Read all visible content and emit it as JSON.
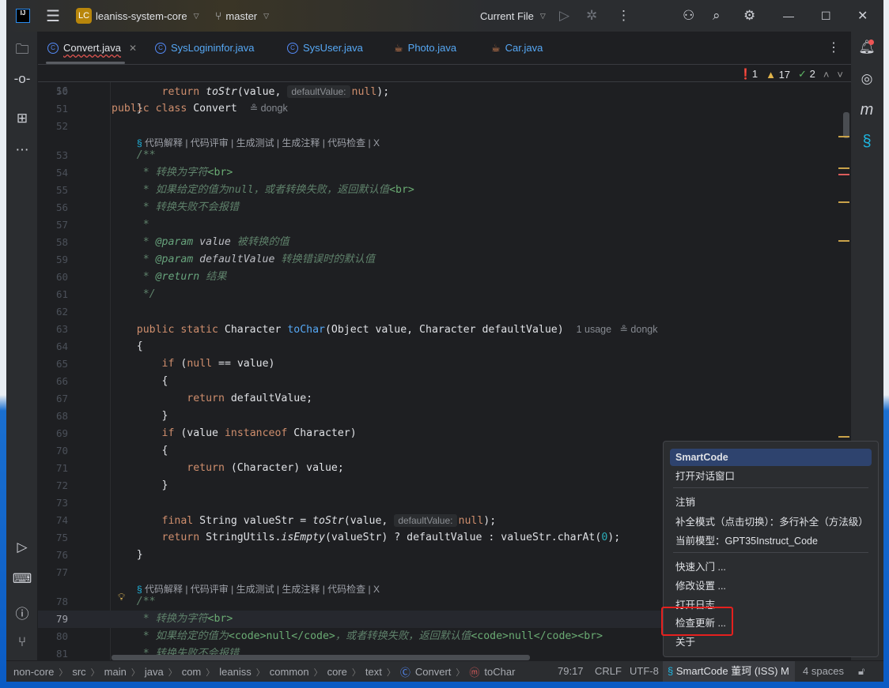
{
  "titlebar": {
    "project_badge": "LC",
    "project": "leaniss-system-core",
    "branch": "master",
    "run_config": "Current File"
  },
  "tabs": [
    {
      "label": "Convert.java",
      "kind": "class",
      "active": true
    },
    {
      "label": "SysLogininfor.java",
      "kind": "class"
    },
    {
      "label": "SysUser.java",
      "kind": "class"
    },
    {
      "label": "Photo.java",
      "kind": "cup"
    },
    {
      "label": "Car.java",
      "kind": "cup"
    }
  ],
  "inspections": {
    "errors": "1",
    "warnings": "17",
    "weak": "2"
  },
  "sticky": {
    "num": "16",
    "code": [
      [
        "kw",
        "public class "
      ],
      [
        "",
        "Convert"
      ]
    ],
    "author": "dongk"
  },
  "lens": {
    "items": "代码解释 | 代码评审 | 生成测试 | 生成注释 | 代码检查 | X"
  },
  "rows": [
    {
      "n": "50",
      "c": [
        [
          "",
          "        "
        ],
        [
          "kw",
          "return "
        ],
        [
          "it",
          "toStr"
        ],
        [
          "",
          "(value, "
        ],
        [
          "hint",
          "defaultValue:"
        ],
        [
          "kw",
          "null"
        ],
        [
          "",
          ");"
        ]
      ]
    },
    {
      "n": "51",
      "c": [
        [
          "",
          "    }"
        ]
      ]
    },
    {
      "n": "52",
      "c": []
    },
    {
      "lens": true
    },
    {
      "n": "53",
      "c": [
        [
          "cm",
          "    /**"
        ]
      ]
    },
    {
      "n": "54",
      "c": [
        [
          "cm",
          "     * 转换为字符"
        ],
        [
          "html",
          "<br>"
        ]
      ]
    },
    {
      "n": "55",
      "c": [
        [
          "cm",
          "     * 如果给定的值为null，或者转换失败，返回默认值"
        ],
        [
          "html",
          "<br>"
        ]
      ]
    },
    {
      "n": "56",
      "c": [
        [
          "cm",
          "     * 转换失败不会报错"
        ]
      ]
    },
    {
      "n": "57",
      "c": [
        [
          "cm",
          "     *"
        ]
      ]
    },
    {
      "n": "58",
      "c": [
        [
          "cm",
          "     * "
        ],
        [
          "tag",
          "@param "
        ],
        [
          "tagv",
          "value "
        ],
        [
          "cm",
          "被转换的值"
        ]
      ]
    },
    {
      "n": "59",
      "c": [
        [
          "cm",
          "     * "
        ],
        [
          "tag",
          "@param "
        ],
        [
          "tagv",
          "defaultValue "
        ],
        [
          "cm",
          "转换错误时的默认值"
        ]
      ]
    },
    {
      "n": "60",
      "c": [
        [
          "cm",
          "     * "
        ],
        [
          "tag",
          "@return "
        ],
        [
          "cm",
          "结果"
        ]
      ]
    },
    {
      "n": "61",
      "c": [
        [
          "cm",
          "     */"
        ]
      ]
    },
    {
      "n": "62",
      "c": []
    },
    {
      "n": "63",
      "c": [
        [
          "",
          "    "
        ],
        [
          "kw",
          "public static "
        ],
        [
          "",
          "Character "
        ],
        [
          "fn",
          "toChar"
        ],
        [
          "",
          "(Object value, Character defaultValue)  "
        ],
        [
          "meta",
          "1 usage   ≗ dongk"
        ]
      ]
    },
    {
      "n": "64",
      "c": [
        [
          "",
          "    {"
        ]
      ]
    },
    {
      "n": "65",
      "c": [
        [
          "",
          "        "
        ],
        [
          "kw",
          "if "
        ],
        [
          "",
          "("
        ],
        [
          "kw",
          "null"
        ],
        [
          "",
          " == value)"
        ]
      ]
    },
    {
      "n": "66",
      "c": [
        [
          "",
          "        {"
        ]
      ]
    },
    {
      "n": "67",
      "c": [
        [
          "",
          "            "
        ],
        [
          "kw",
          "return "
        ],
        [
          "",
          "defaultValue;"
        ]
      ]
    },
    {
      "n": "68",
      "c": [
        [
          "",
          "        }"
        ]
      ]
    },
    {
      "n": "69",
      "c": [
        [
          "",
          "        "
        ],
        [
          "kw",
          "if "
        ],
        [
          "",
          "(value "
        ],
        [
          "kw",
          "instanceof "
        ],
        [
          "",
          "Character)"
        ]
      ]
    },
    {
      "n": "70",
      "c": [
        [
          "",
          "        {"
        ]
      ]
    },
    {
      "n": "71",
      "c": [
        [
          "",
          "            "
        ],
        [
          "kw",
          "return "
        ],
        [
          "",
          "(Character) value;"
        ]
      ]
    },
    {
      "n": "72",
      "c": [
        [
          "",
          "        }"
        ]
      ]
    },
    {
      "n": "73",
      "c": []
    },
    {
      "n": "74",
      "c": [
        [
          "",
          "        "
        ],
        [
          "kw",
          "final "
        ],
        [
          "",
          "String valueStr = "
        ],
        [
          "it",
          "toStr"
        ],
        [
          "",
          "(value, "
        ],
        [
          "hint",
          "defaultValue:"
        ],
        [
          "kw",
          "null"
        ],
        [
          "",
          ");"
        ]
      ]
    },
    {
      "n": "75",
      "c": [
        [
          "",
          "        "
        ],
        [
          "kw",
          "return "
        ],
        [
          "",
          "StringUtils."
        ],
        [
          "it",
          "isEmpty"
        ],
        [
          "",
          "(valueStr) ? defaultValue : valueStr.charAt("
        ],
        [
          "num0",
          "0"
        ],
        [
          "",
          ");"
        ]
      ]
    },
    {
      "n": "76",
      "c": [
        [
          "",
          "    }"
        ]
      ]
    },
    {
      "n": "77",
      "c": []
    },
    {
      "lens": true
    },
    {
      "n": "78",
      "c": [
        [
          "cm",
          "    /**"
        ]
      ]
    },
    {
      "n": "79",
      "cur": true,
      "c": [
        [
          "cm",
          "     * 转换为字符"
        ],
        [
          "html",
          "<br>"
        ]
      ]
    },
    {
      "n": "80",
      "c": [
        [
          "cm",
          "     * 如果给定的值为"
        ],
        [
          "html",
          "<code>null</code>"
        ],
        [
          "cm",
          "，或者转换失败，返回默认值"
        ],
        [
          "html",
          "<code>null</code><br>"
        ]
      ]
    },
    {
      "n": "81",
      "c": [
        [
          "cm",
          "     * 转换失败不会报错"
        ]
      ]
    }
  ],
  "popup": {
    "items": [
      "SmartCode",
      "打开对话窗口",
      "注销",
      "补全模式（点击切换）：多行补全（方法级）",
      "当前模型：GPT35Instruct_Code",
      "快速入门 ...",
      "修改设置 ...",
      "打开日志",
      "检查更新 ...",
      "关于"
    ]
  },
  "status": {
    "crumbs": [
      "non-core",
      "src",
      "main",
      "java",
      "com",
      "leaniss",
      "common",
      "core",
      "text",
      "Convert",
      "toChar"
    ],
    "position": "79:17",
    "line_sep": "CRLF",
    "encoding": "UTF-8",
    "smartcode": "SmartCode 董珂 (ISS) M",
    "indent": "4 spaces"
  },
  "colors": {
    "accent": "#548af7",
    "error": "#db5c5c",
    "warning": "#e0b34a",
    "highlight": "#e5201e"
  }
}
